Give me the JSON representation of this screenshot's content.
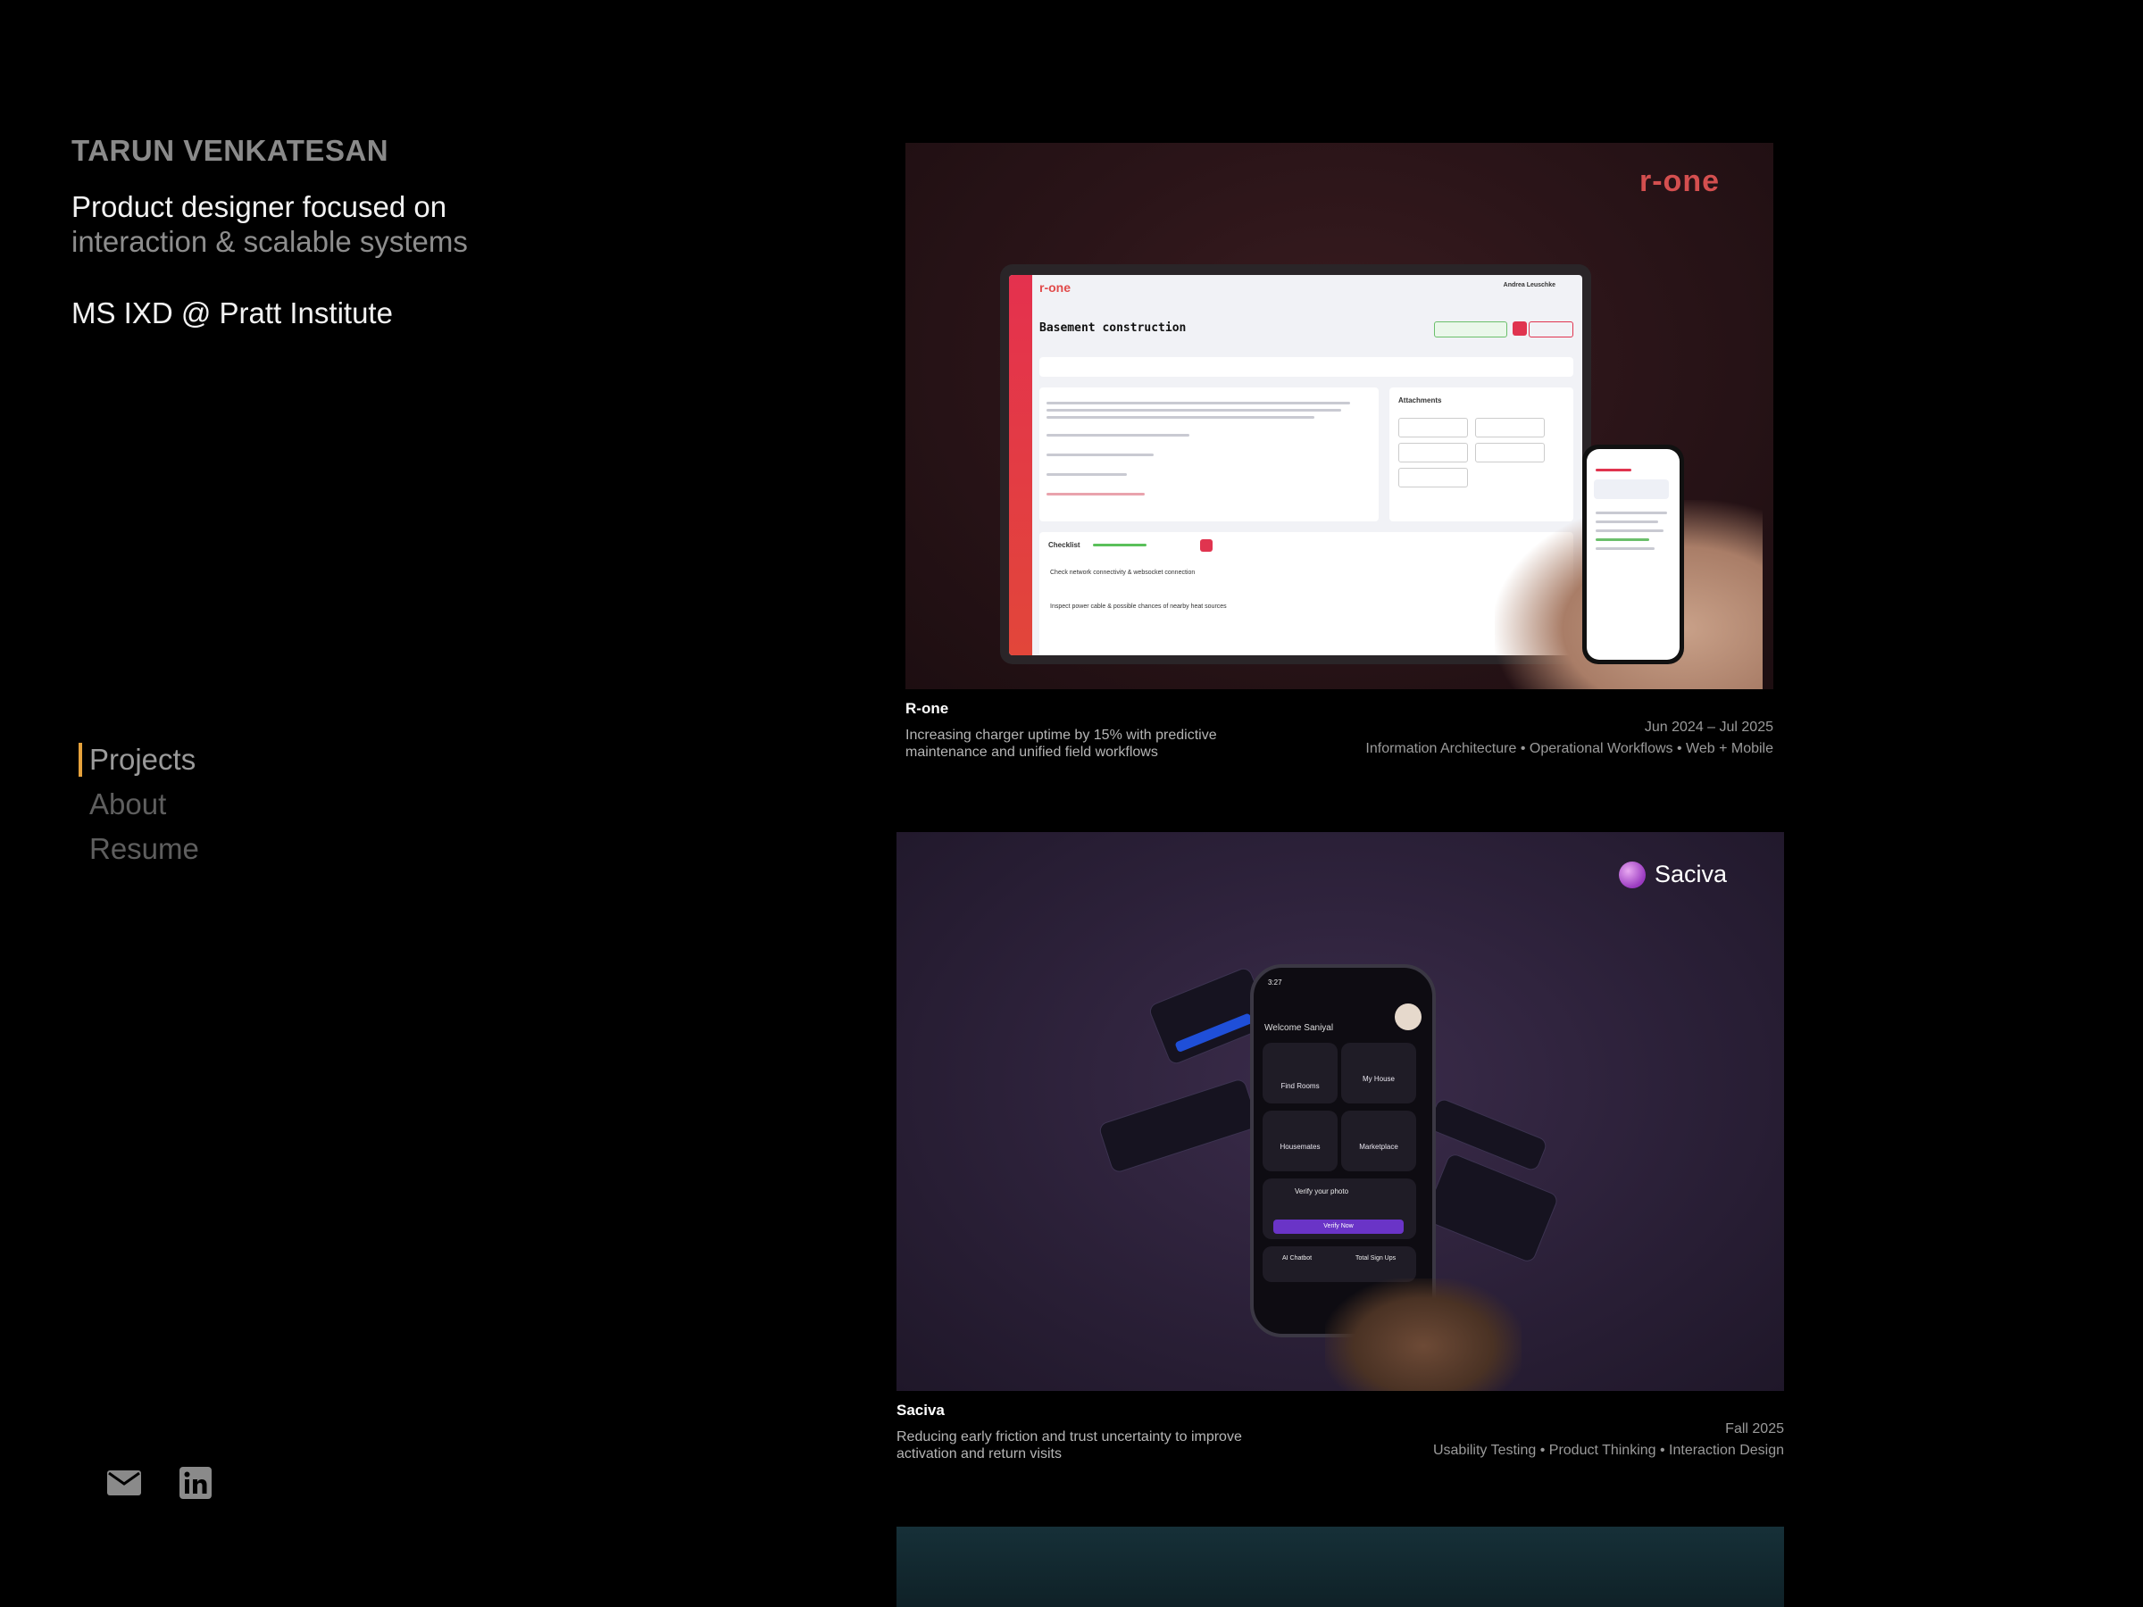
{
  "profile": {
    "name": "TARUN VENKATESAN",
    "tagline_1": "Product designer focused on",
    "tagline_2": "interaction & scalable systems",
    "education": "MS IXD @ Pratt Institute"
  },
  "nav": {
    "items": [
      {
        "label": "Projects",
        "active": true
      },
      {
        "label": "About",
        "active": false
      },
      {
        "label": "Resume",
        "active": false
      }
    ],
    "accent_color": "#e6a23c"
  },
  "social": [
    {
      "icon": "mail-icon"
    },
    {
      "icon": "linkedin-icon"
    }
  ],
  "projects": [
    {
      "title": "R-one",
      "description": "Increasing charger uptime by 15% with predictive maintenance and unified field workflows",
      "date": "Jun 2024 – Jul 2025",
      "tags": "Information Architecture • Operational Workflows • Web + Mobile",
      "thumbnail": {
        "brand": "r-one",
        "app_logo": "r-one",
        "screen_title": "Basement construction",
        "attachments_label": "Attachments",
        "checklist_label": "Checklist",
        "checklist_item_1": "Check network connectivity & websocket connection",
        "checklist_item_2": "Inspect power cable & possible chances of nearby heat sources",
        "user_name": "Andrea Leuschke",
        "brand_color": "#d44f4f"
      }
    },
    {
      "title": "Saciva",
      "description": "Reducing early friction and trust uncertainty to improve activation and return visits",
      "date": "Fall 2025",
      "tags": "Usability Testing • Product Thinking • Interaction Design",
      "thumbnail": {
        "brand": "Saciva",
        "phone_time": "3:27",
        "welcome": "Welcome Saniyal",
        "tiles": [
          "Find Rooms",
          "My House",
          "Housemates",
          "Marketplace"
        ],
        "verify_title": "Verify your photo",
        "verify_button": "Verify Now",
        "ai_chatbot": "AI Chatbot",
        "total_sign_ups": "Total Sign Ups"
      }
    }
  ]
}
